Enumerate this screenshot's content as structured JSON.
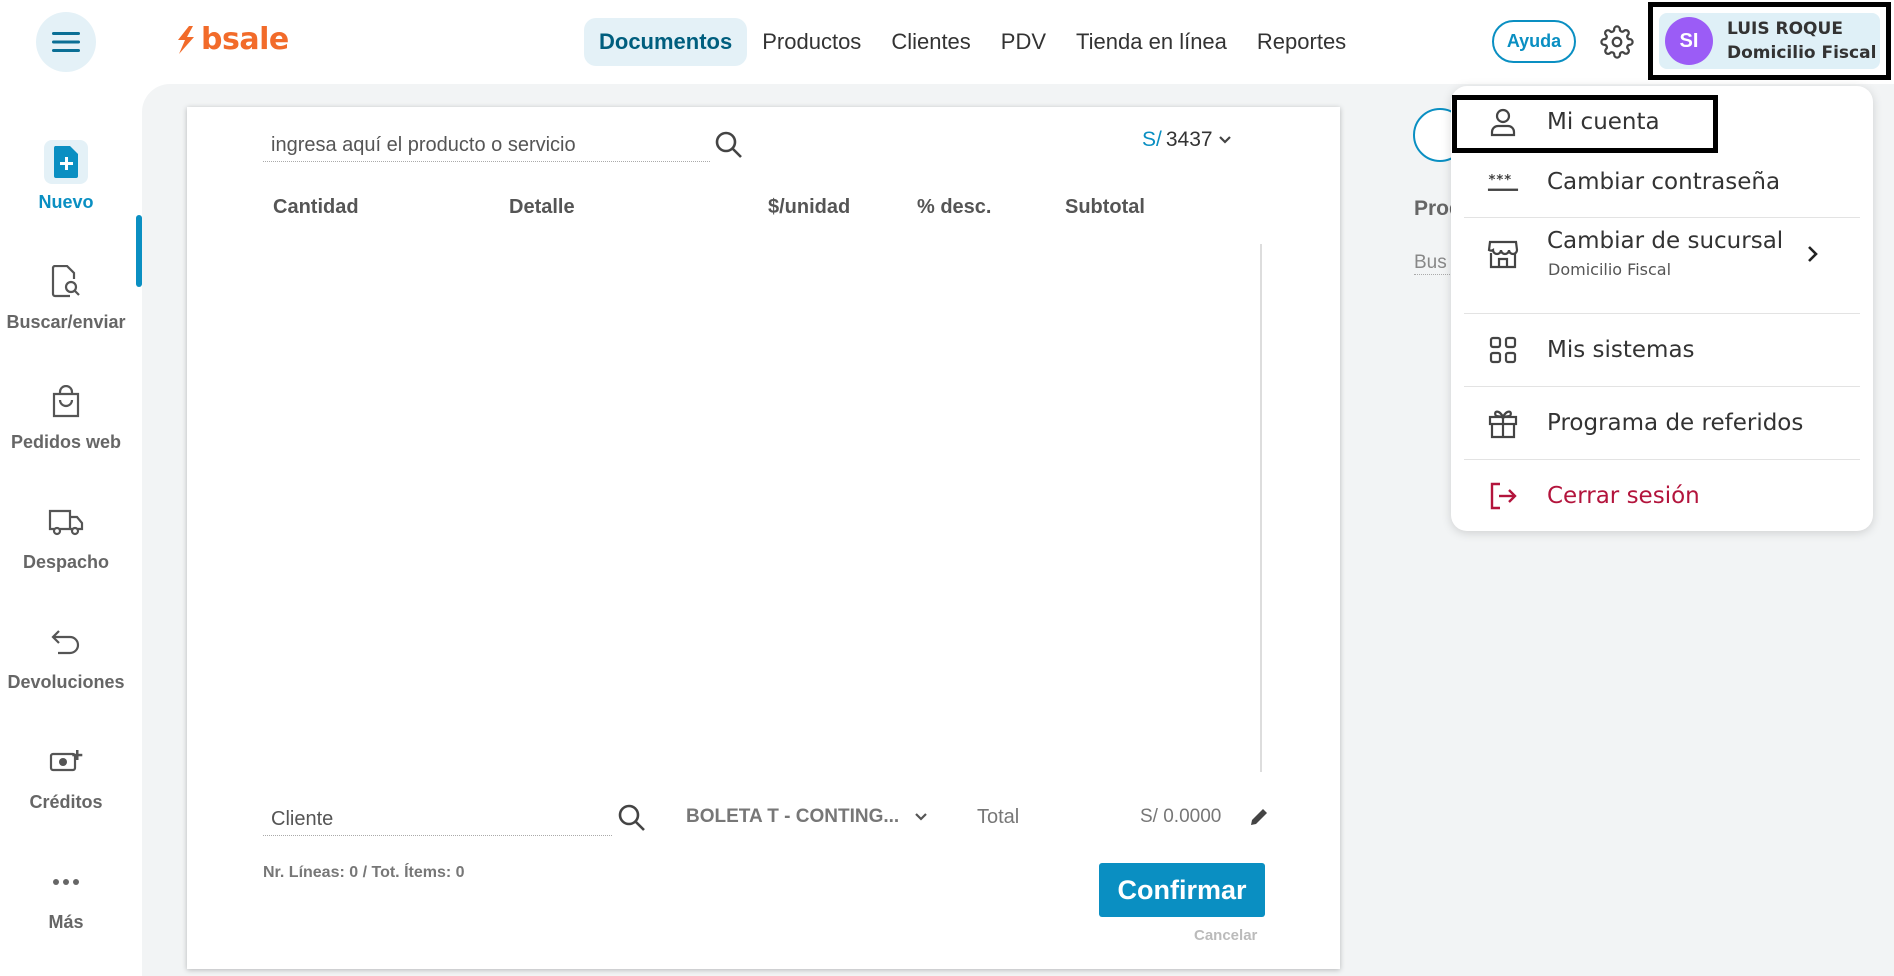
{
  "topbar": {
    "logo_text": "bsale",
    "nav": [
      {
        "label": "Documentos",
        "active": true
      },
      {
        "label": "Productos",
        "active": false
      },
      {
        "label": "Clientes",
        "active": false
      },
      {
        "label": "PDV",
        "active": false
      },
      {
        "label": "Tienda en línea",
        "active": false
      },
      {
        "label": "Reportes",
        "active": false
      }
    ],
    "help_label": "Ayuda",
    "user": {
      "initials": "SI",
      "name": "LUIS ROQUE",
      "branch": "Domicilio Fiscal",
      "avatar_color": "#9b5cf6"
    }
  },
  "sidebar": {
    "items": [
      {
        "label": "Nuevo",
        "icon": "new-document-icon",
        "active": true
      },
      {
        "label": "Buscar/enviar",
        "icon": "document-search-icon",
        "active": false
      },
      {
        "label": "Pedidos web",
        "icon": "shopping-bag-icon",
        "active": false
      },
      {
        "label": "Despacho",
        "icon": "truck-icon",
        "active": false
      },
      {
        "label": "Devoluciones",
        "icon": "undo-arrow-icon",
        "active": false
      },
      {
        "label": "Créditos",
        "icon": "money-plus-icon",
        "active": false
      },
      {
        "label": "Más",
        "icon": "more-dots-icon",
        "active": false
      }
    ]
  },
  "document": {
    "product_input_placeholder": "ingresa aquí el producto o servicio",
    "price_list_currency": "S/",
    "price_list_number": "3437",
    "columns": [
      "Cantidad",
      "Detalle",
      "$/unidad",
      "% desc.",
      "Subtotal"
    ],
    "client_placeholder": "Cliente",
    "doc_type": "BOLETA T - CONTING...",
    "total_label": "Total",
    "total_value": "S/ 0.0000",
    "lines_info": "Nr. Líneas: 0 / Tot. Ítems: 0",
    "confirm_label": "Confirmar",
    "cancel_label": "Cancelar"
  },
  "right_panel": {
    "label_partial": "Prod",
    "input_partial": "Bus"
  },
  "user_menu": {
    "items": [
      {
        "label": "Mi cuenta",
        "icon": "user-icon"
      },
      {
        "label": "Cambiar contraseña",
        "icon": "password-icon"
      },
      {
        "label": "Cambiar de sucursal",
        "sublabel": "Domicilio Fiscal",
        "icon": "store-icon"
      },
      {
        "label": "Mis sistemas",
        "icon": "grid-icon"
      },
      {
        "label": "Programa de referidos",
        "icon": "gift-icon"
      },
      {
        "label": "Cerrar sesión",
        "icon": "logout-icon",
        "color": "#b3143c"
      }
    ]
  },
  "colors": {
    "accent": "#0a8fc2",
    "brand": "#f26b2a",
    "danger": "#b3143c"
  }
}
